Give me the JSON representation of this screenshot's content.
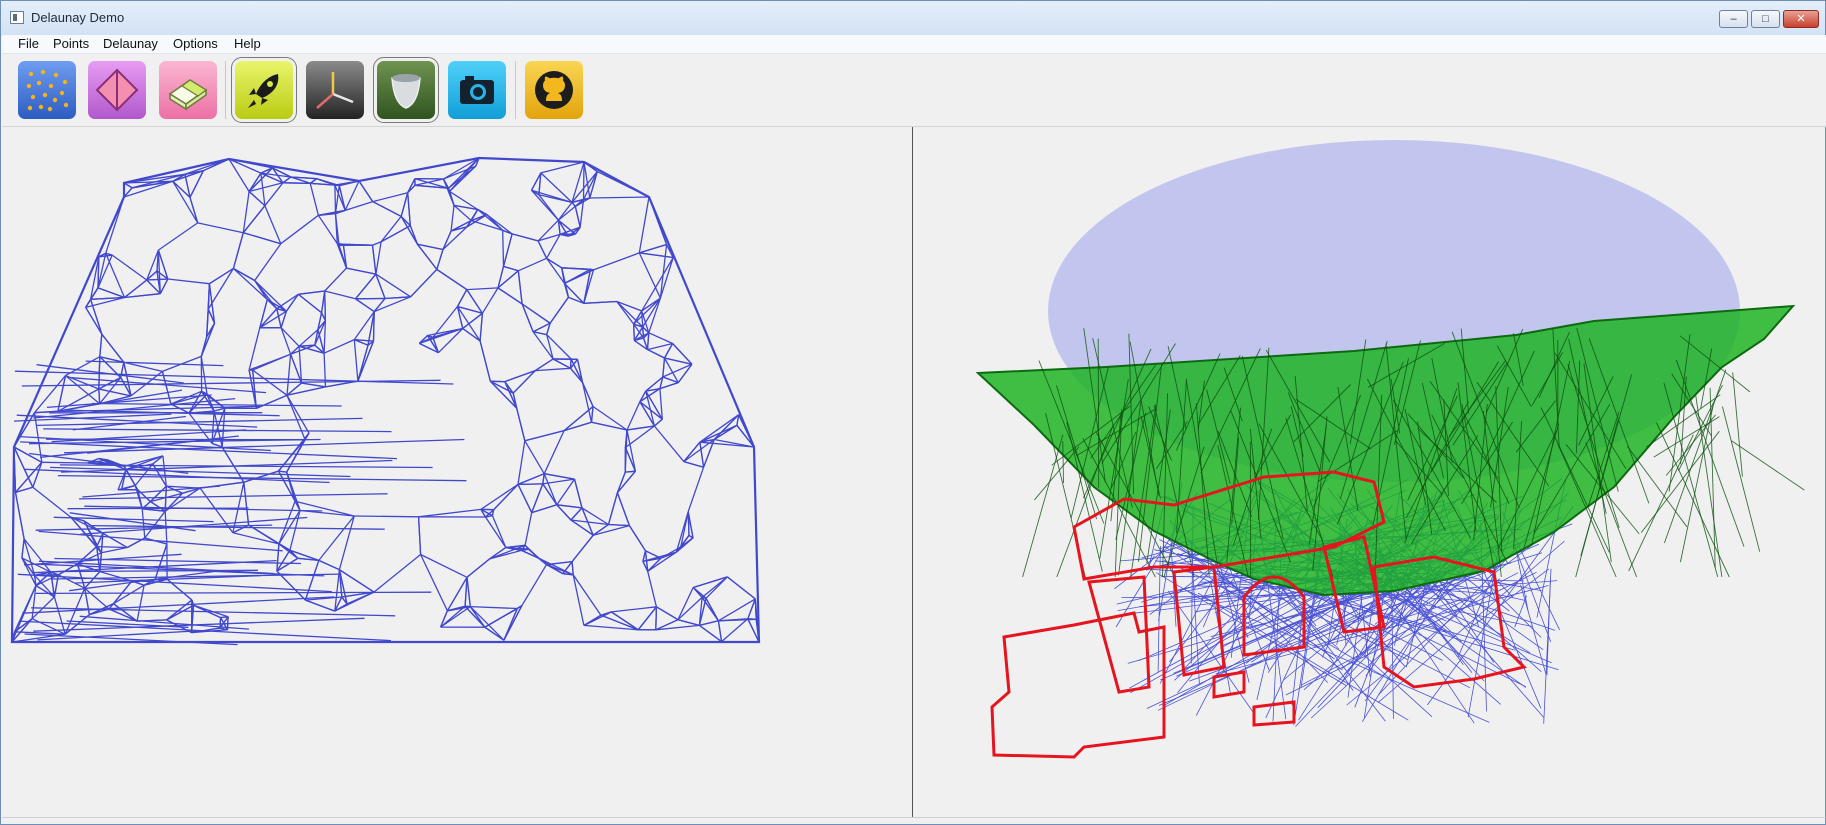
{
  "window": {
    "title": "Delaunay Demo",
    "controls": {
      "minimize": "–",
      "maximize": "□",
      "close": "✕"
    }
  },
  "menubar": {
    "items": [
      {
        "label": "File"
      },
      {
        "label": "Points"
      },
      {
        "label": "Delaunay"
      },
      {
        "label": "Options"
      },
      {
        "label": "Help"
      }
    ]
  },
  "toolbar": {
    "buttons": [
      {
        "icon": "random-points-icon",
        "color": "#3e6fcf",
        "checked": false
      },
      {
        "icon": "diamond-triangulation-icon",
        "color": "#c86bdc",
        "checked": false
      },
      {
        "icon": "eraser-icon",
        "color": "#f08bb6",
        "checked": false
      },
      {
        "icon": "rocket-icon",
        "color": "#cde02a",
        "checked": true
      },
      {
        "icon": "axes-icon",
        "color": "#3a3a3a",
        "checked": false
      },
      {
        "icon": "paraboloid-icon",
        "color": "#3f6b2a",
        "checked": true
      },
      {
        "icon": "camera-icon",
        "color": "#28b3ea",
        "checked": false
      },
      {
        "icon": "github-icon",
        "color": "#f2b81d",
        "checked": false
      }
    ]
  },
  "views": {
    "left": {
      "name": "2d-delaunay-view",
      "mesh_color": "#4148cc"
    },
    "right": {
      "name": "3d-lifted-view",
      "ellipse_color": "#c2c6ee",
      "surface_color": "#19b21d",
      "outline_color": "#e5141e",
      "mesh_color": "#4a52d6"
    }
  }
}
